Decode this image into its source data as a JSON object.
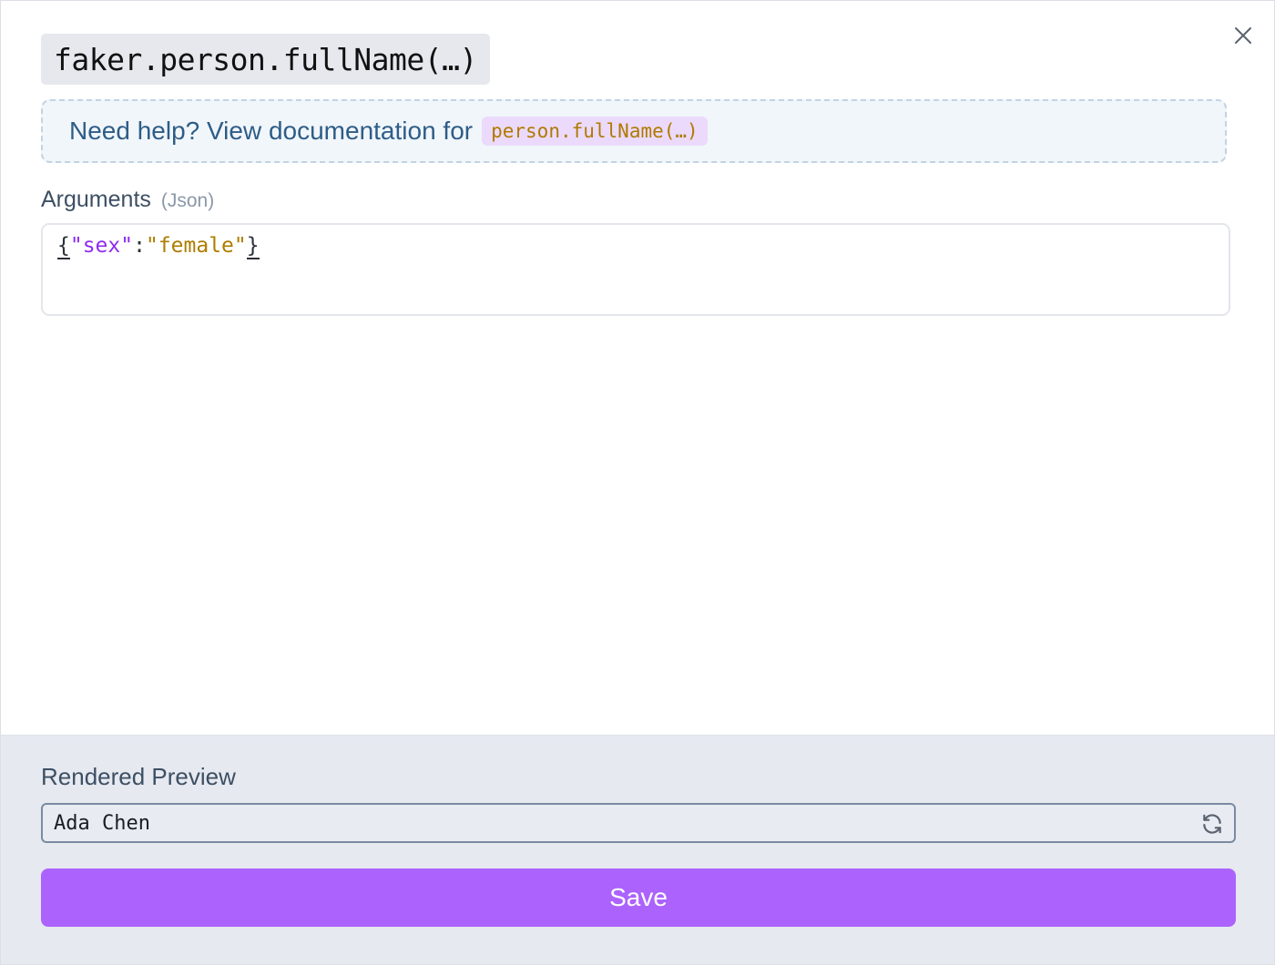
{
  "dialog": {
    "title": "faker.person.fullName(…)",
    "close_icon": "close-icon"
  },
  "help": {
    "text": "Need help? View documentation for",
    "link_label": "person.fullName(…)"
  },
  "arguments": {
    "label": "Arguments",
    "hint": "(Json)",
    "editor_tokens": {
      "open_brace": "{",
      "key": "\"sex\"",
      "colon": ":",
      "value": "\"female\"",
      "close_brace": "}"
    }
  },
  "preview": {
    "label": "Rendered Preview",
    "value": "Ada Chen",
    "refresh_icon": "refresh-icon"
  },
  "actions": {
    "save_label": "Save"
  },
  "colors": {
    "accent": "#ac62fd",
    "help_text": "#2e5d86",
    "json_key": "#8f2bf0",
    "json_string": "#ad7d00"
  }
}
